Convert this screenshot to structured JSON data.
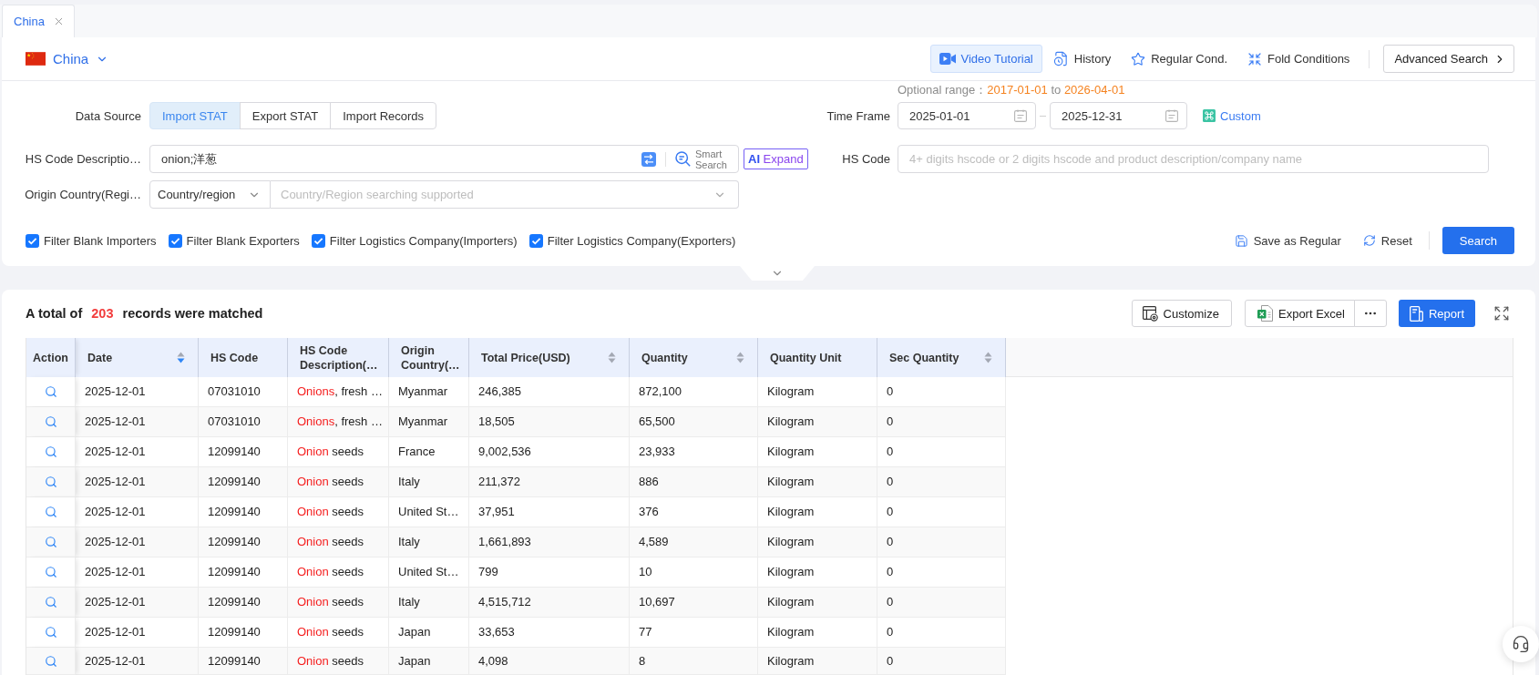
{
  "tabs": [
    {
      "label": "China",
      "selected": true
    }
  ],
  "header": {
    "country": "China",
    "actions": [
      {
        "kind": "video",
        "label": "Video Tutorial",
        "selected": true
      },
      {
        "kind": "history",
        "label": "History",
        "selected": false
      },
      {
        "kind": "star",
        "label": "Regular Cond.",
        "selected": false
      },
      {
        "kind": "fold",
        "label": "Fold Conditions",
        "selected": false
      }
    ],
    "advanced_search": "Advanced Search"
  },
  "form": {
    "optional_range": {
      "label": "Optional range：",
      "from": "2017-01-01",
      "connector": "to",
      "to": "2026-04-01"
    },
    "data_source": {
      "label": "Data Source",
      "options": [
        {
          "label": "Import STAT",
          "selected": true
        },
        {
          "label": "Export STAT",
          "selected": false
        },
        {
          "label": "Import Records",
          "selected": false
        }
      ]
    },
    "time_frame": {
      "label": "Time Frame",
      "start": "2025-01-01",
      "end": "2025-12-31",
      "custom": "Custom"
    },
    "hs_description": {
      "label": "HS Code Descriptio…",
      "value": "onion;洋葱",
      "smart_search": "Smart Search",
      "ai_expand": "**AI** Expand"
    },
    "hs_code": {
      "label": "HS Code",
      "placeholder": "4+ digits hscode or 2 digits hscode and product description/company name"
    },
    "origin": {
      "label": "Origin Country(Regi…",
      "select": "Country/region",
      "placeholder": "Country/Region searching supported"
    },
    "filters": [
      {
        "label": "Filter Blank Importers",
        "checked": true
      },
      {
        "label": "Filter Blank Exporters",
        "checked": true
      },
      {
        "label": "Filter Logistics Company(Importers)",
        "checked": true
      },
      {
        "label": "Filter Logistics Company(Exporters)",
        "checked": true
      }
    ],
    "save": "Save as Regular",
    "reset": "Reset",
    "search": "Search"
  },
  "results": {
    "prefix": "A total of",
    "count": "203",
    "suffix": "records were matched",
    "customize": "Customize",
    "export": "Export Excel",
    "report": "Report"
  },
  "table": {
    "columns": [
      {
        "label": "Action",
        "sortable": false
      },
      {
        "label": "Date",
        "sortable": true,
        "sorted_descending": true
      },
      {
        "label": "HS Code",
        "sortable": false
      },
      {
        "label": "HS Code Description(…",
        "sortable": false
      },
      {
        "label": "Origin Country(…",
        "sortable": false
      },
      {
        "label": "Total Price(USD)",
        "sortable": true,
        "sorted_descending": false
      },
      {
        "label": "Quantity",
        "sortable": true,
        "sorted_descending": false
      },
      {
        "label": "Quantity Unit",
        "sortable": false
      },
      {
        "label": "Sec Quantity",
        "sortable": true,
        "sorted_descending": false
      }
    ],
    "rows": [
      {
        "date": "2025-12-01",
        "hs_code": "07031010",
        "description": {
          "match": "Onions",
          "rest": ", fresh …"
        },
        "origin": "Myanmar",
        "total_price": "246,385",
        "quantity": "872,100",
        "unit": "Kilogram",
        "sec_quantity": "0"
      },
      {
        "date": "2025-12-01",
        "hs_code": "07031010",
        "description": {
          "match": "Onions",
          "rest": ", fresh …"
        },
        "origin": "Myanmar",
        "total_price": "18,505",
        "quantity": "65,500",
        "unit": "Kilogram",
        "sec_quantity": "0"
      },
      {
        "date": "2025-12-01",
        "hs_code": "12099140",
        "description": {
          "match": "Onion",
          "rest": " seeds"
        },
        "origin": "France",
        "total_price": "9,002,536",
        "quantity": "23,933",
        "unit": "Kilogram",
        "sec_quantity": "0"
      },
      {
        "date": "2025-12-01",
        "hs_code": "12099140",
        "description": {
          "match": "Onion",
          "rest": " seeds"
        },
        "origin": "Italy",
        "total_price": "211,372",
        "quantity": "886",
        "unit": "Kilogram",
        "sec_quantity": "0"
      },
      {
        "date": "2025-12-01",
        "hs_code": "12099140",
        "description": {
          "match": "Onion",
          "rest": " seeds"
        },
        "origin": "United St…",
        "total_price": "37,951",
        "quantity": "376",
        "unit": "Kilogram",
        "sec_quantity": "0"
      },
      {
        "date": "2025-12-01",
        "hs_code": "12099140",
        "description": {
          "match": "Onion",
          "rest": " seeds"
        },
        "origin": "Italy",
        "total_price": "1,661,893",
        "quantity": "4,589",
        "unit": "Kilogram",
        "sec_quantity": "0"
      },
      {
        "date": "2025-12-01",
        "hs_code": "12099140",
        "description": {
          "match": "Onion",
          "rest": " seeds"
        },
        "origin": "United St…",
        "total_price": "799",
        "quantity": "10",
        "unit": "Kilogram",
        "sec_quantity": "0"
      },
      {
        "date": "2025-12-01",
        "hs_code": "12099140",
        "description": {
          "match": "Onion",
          "rest": " seeds"
        },
        "origin": "Italy",
        "total_price": "4,515,712",
        "quantity": "10,697",
        "unit": "Kilogram",
        "sec_quantity": "0"
      },
      {
        "date": "2025-12-01",
        "hs_code": "12099140",
        "description": {
          "match": "Onion",
          "rest": " seeds"
        },
        "origin": "Japan",
        "total_price": "33,653",
        "quantity": "77",
        "unit": "Kilogram",
        "sec_quantity": "0"
      },
      {
        "date": "2025-12-01",
        "hs_code": "12099140",
        "description": {
          "match": "Onion",
          "rest": " seeds"
        },
        "origin": "Japan",
        "total_price": "4,098",
        "quantity": "8",
        "unit": "Kilogram",
        "sec_quantity": "0"
      }
    ]
  }
}
